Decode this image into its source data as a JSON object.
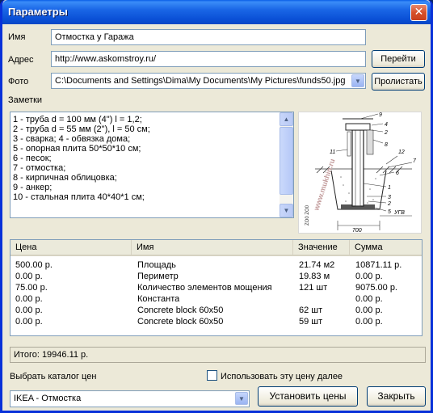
{
  "window": {
    "title": "Параметры"
  },
  "form": {
    "name_label": "Имя",
    "name_value": "Отмостка у Гаража",
    "address_label": "Адрес",
    "address_value": "http://www.askomstroy.ru/",
    "go_button": "Перейти",
    "photo_label": "Фото",
    "photo_value": "C:\\Documents and Settings\\Dima\\My Documents\\My Pictures\\funds50.jpg",
    "browse_button": "Пролистать",
    "notes_label": "Заметки"
  },
  "notes": [
    "1 - труба d = 100 мм (4\") l = 1,2;",
    "2 - труба d = 55 мм (2\"), l = 50 см;",
    "3 - сварка; 4 - обвязка дома;",
    "5 - опорная плита 50*50*10 см;",
    "6 - песок;",
    "7 - отмостка;",
    "8 - кирпичная облицовка;",
    "9 - анкер;",
    "10 - стальная плита 40*40*1 см;"
  ],
  "photo": {
    "labels": [
      "9",
      "4",
      "2",
      "8",
      "11",
      "12",
      "7",
      "6",
      "1",
      "3",
      "2",
      "5",
      "УГВ",
      "700"
    ],
    "watermark": "www.mukhin.ru",
    "stamp": "ZO0 ZO0"
  },
  "table": {
    "headers": [
      "Цена",
      "Имя",
      "Значение",
      "Сумма"
    ],
    "rows": [
      [
        "500.00 р.",
        "Площадь",
        "21.74 м2",
        "10871.11 р."
      ],
      [
        "0.00 р.",
        "Периметр",
        "19.83 м",
        "0.00 р."
      ],
      [
        "75.00 р.",
        "Количество элементов мощения",
        "121 шт",
        "9075.00 р."
      ],
      [
        "0.00 р.",
        "Константа",
        "",
        "0.00 р."
      ],
      [
        "0.00 р.",
        "Concrete block 60x50",
        "62 шт",
        "0.00 р."
      ],
      [
        "0.00 р.",
        "Concrete block 60x50",
        "59 шт",
        "0.00 р."
      ]
    ]
  },
  "total": "Итого: 19946.11 р.",
  "catalog": {
    "label": "Выбрать каталог цен",
    "use_price_label": "Использовать эту цену далее",
    "selected": "IKEA - Отмостка",
    "set_prices_button": "Установить цены",
    "close_button": "Закрыть"
  }
}
